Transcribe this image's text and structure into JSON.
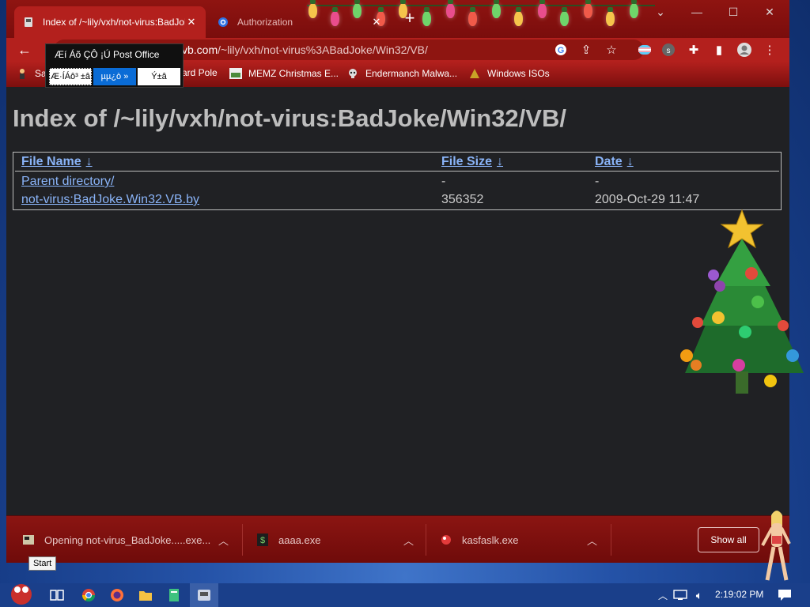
{
  "tabs": [
    {
      "title": "Index of /~lily/vxh/not-virus:BadJoke/Win32/VB/",
      "active": true
    },
    {
      "title": "Authorization",
      "active": false
    }
  ],
  "address": {
    "host_partial": "vb.com",
    "path": "/~lily/vxh/not-virus%3ABadJoke/Win32/VB/"
  },
  "bookmarks": [
    {
      "label": "Sa",
      "icon": "bookmark-person-icon"
    },
    {
      "label": "ard Pole",
      "icon": "bookmark-icon"
    },
    {
      "label": "MEMZ Christmas E...",
      "icon": "memz-icon"
    },
    {
      "label": "Endermanch Malwa...",
      "icon": "skull-icon"
    },
    {
      "label": "Windows ISOs",
      "icon": "folder-icon"
    }
  ],
  "popup": {
    "title": "Æí Áõ ÇÔ ¡Ú Post Office",
    "btn1": "Æ·ÍÁô³ ±â",
    "btn2": "µµ¿ò »",
    "btn3": "Ý±â"
  },
  "page": {
    "title": "Index of /~lily/vxh/not-virus:BadJoke/Win32/VB/",
    "headers": {
      "name": "File Name",
      "size": "File Size",
      "date": "Date",
      "sort_arrow": "↓"
    },
    "rows": [
      {
        "name": "Parent directory/",
        "size": "-",
        "date": "-"
      },
      {
        "name": "not-virus:BadJoke.Win32.VB.by",
        "size": "356352",
        "date": "2009-Oct-29 11:47"
      }
    ]
  },
  "downloads": {
    "items": [
      {
        "label": "Opening not-virus_BadJoke.....exe...",
        "icon": "file-icon"
      },
      {
        "label": "aaaa.exe",
        "icon": "money-icon"
      },
      {
        "label": "kasfaslk.exe",
        "icon": "red-blob-icon"
      }
    ],
    "show_all": "Show all"
  },
  "taskbar": {
    "clock": "2:19:02 PM",
    "tooltip": "Start"
  },
  "colors": {
    "accent": "#b3201d",
    "link": "#8ab4f8",
    "page_bg": "#202124",
    "desktop": "#2553a8"
  }
}
